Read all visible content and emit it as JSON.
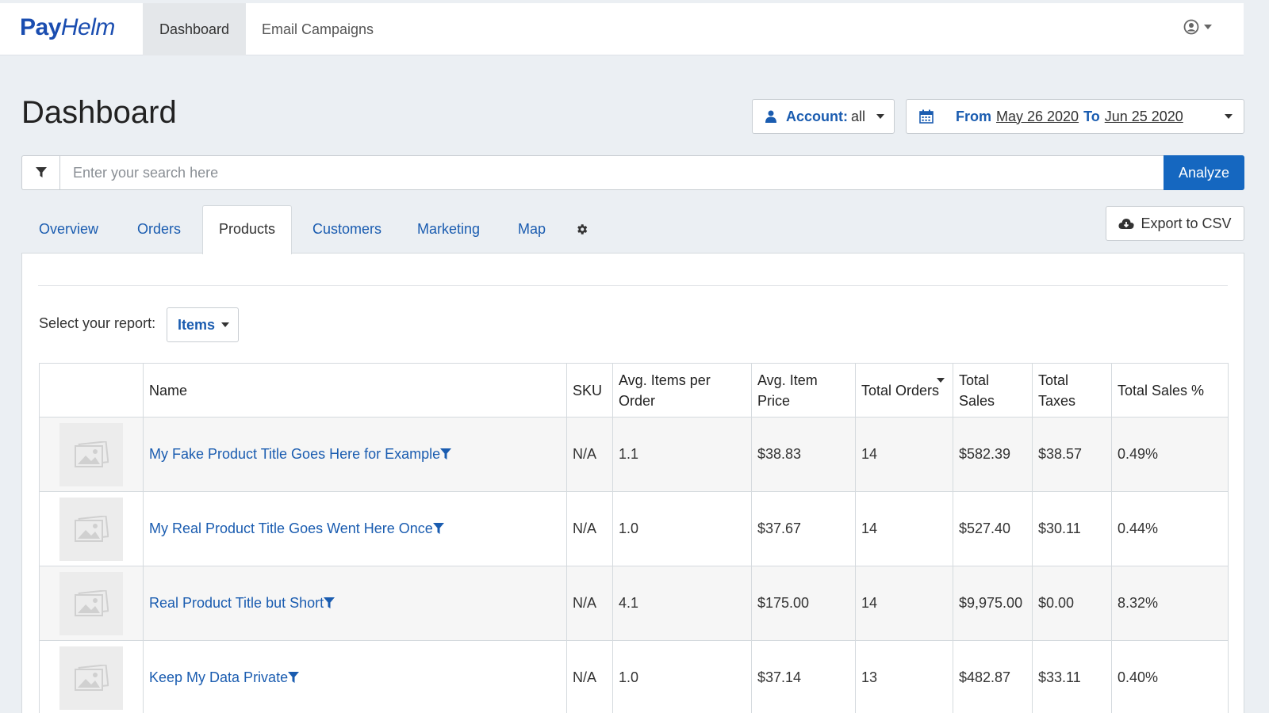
{
  "brand": {
    "part1": "Pay",
    "part2": "Helm"
  },
  "topnav": {
    "tabs": [
      {
        "label": "Dashboard",
        "active": true
      },
      {
        "label": "Email Campaigns",
        "active": false
      }
    ],
    "user_icon": "user-circle-icon"
  },
  "header": {
    "title": "Dashboard",
    "account": {
      "label": "Account:",
      "value": "all"
    },
    "date_range": {
      "from_label": "From",
      "from": "May 26 2020",
      "to_label": "To",
      "to": "Jun 25 2020"
    }
  },
  "search": {
    "placeholder": "Enter your search here",
    "value": "",
    "button": "Analyze"
  },
  "tabs": [
    {
      "label": "Overview",
      "active": false
    },
    {
      "label": "Orders",
      "active": false
    },
    {
      "label": "Products",
      "active": true
    },
    {
      "label": "Customers",
      "active": false
    },
    {
      "label": "Marketing",
      "active": false
    },
    {
      "label": "Map",
      "active": false
    }
  ],
  "export_label": "Export to CSV",
  "report": {
    "label": "Select your report:",
    "selected": "Items"
  },
  "table": {
    "columns": [
      "",
      "Name",
      "SKU",
      "Avg. Items per Order",
      "Avg. Item Price",
      "Total Orders",
      "Total Sales",
      "Total Taxes",
      "Total Sales %"
    ],
    "sorted_by": "Total Orders",
    "rows": [
      {
        "name": "My Fake Product Title Goes Here for Example",
        "sku": "N/A",
        "avg_items": "1.1",
        "avg_price": "$38.83",
        "orders": "14",
        "sales": "$582.39",
        "taxes": "$38.57",
        "pct": "0.49%"
      },
      {
        "name": "My Real Product Title Goes Went Here Once",
        "sku": "N/A",
        "avg_items": "1.0",
        "avg_price": "$37.67",
        "orders": "14",
        "sales": "$527.40",
        "taxes": "$30.11",
        "pct": "0.44%"
      },
      {
        "name": "Real Product Title but Short",
        "sku": "N/A",
        "avg_items": "4.1",
        "avg_price": "$175.00",
        "orders": "14",
        "sales": "$9,975.00",
        "taxes": "$0.00",
        "pct": "8.32%"
      },
      {
        "name": "Keep My Data Private",
        "sku": "N/A",
        "avg_items": "1.0",
        "avg_price": "$37.14",
        "orders": "13",
        "sales": "$482.87",
        "taxes": "$33.11",
        "pct": "0.40%"
      }
    ]
  },
  "colors": {
    "link": "#1a5cb0",
    "primary_button": "#1567c0",
    "brand": "#1a4db0"
  }
}
